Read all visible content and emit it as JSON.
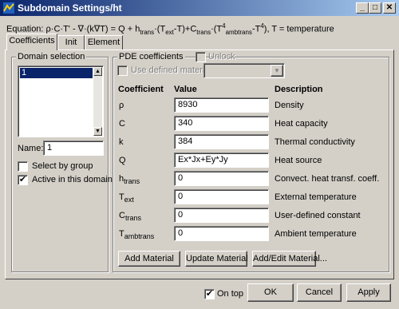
{
  "window": {
    "title": "Subdomain Settings/ht",
    "minimize": "_",
    "maximize": "□",
    "close": "✕"
  },
  "equation": {
    "p1": "Equation: ρ·C·T' - ∇·(k∇T) = Q + h",
    "trans1": "trans",
    "p2": "·(T",
    "ext": "ext",
    "p3": "-T)+C",
    "trans2": "trans",
    "p4": "·(T",
    "four1": "4",
    "ambtrans": "ambtrans",
    "p5": "-T",
    "four2": "4",
    "p6": "), T = temperature"
  },
  "tabs": [
    "Coefficients",
    "Init",
    "Element"
  ],
  "domain_selection": {
    "title": "Domain selection",
    "items": [
      "1"
    ],
    "name_label": "Name:",
    "name_value": "1",
    "select_by_group": "Select by group",
    "active_in_domain": "Active in this domain",
    "active_checked": "✔"
  },
  "pde": {
    "title": "PDE coefficients",
    "unlock": "Unlock",
    "use_defined": "Use defined material",
    "headers": {
      "coefficient": "Coefficient",
      "value": "Value",
      "description": "Description"
    },
    "rows": [
      {
        "sym": "ρ",
        "sub": "",
        "value": "8930",
        "desc": "Density"
      },
      {
        "sym": "C",
        "sub": "",
        "value": "340",
        "desc": "Heat capacity"
      },
      {
        "sym": "k",
        "sub": "",
        "value": "384",
        "desc": "Thermal conductivity"
      },
      {
        "sym": "Q",
        "sub": "",
        "value": "Ex*Jx+Ey*Jy",
        "desc": "Heat source"
      },
      {
        "sym": "h",
        "sub": "trans",
        "value": "0",
        "desc": "Convect. heat transf. coeff."
      },
      {
        "sym": "T",
        "sub": "ext",
        "value": "0",
        "desc": "External temperature"
      },
      {
        "sym": "C",
        "sub": "trans",
        "value": "0",
        "desc": "User-defined constant"
      },
      {
        "sym": "T",
        "sub": "ambtrans",
        "value": "0",
        "desc": "Ambient temperature"
      }
    ],
    "buttons": {
      "add": "Add Material",
      "update": "Update Material",
      "addedit": "Add/Edit Material..."
    }
  },
  "footer": {
    "on_top": "On top",
    "on_top_checked": "✔",
    "ok": "OK",
    "cancel": "Cancel",
    "apply": "Apply"
  }
}
